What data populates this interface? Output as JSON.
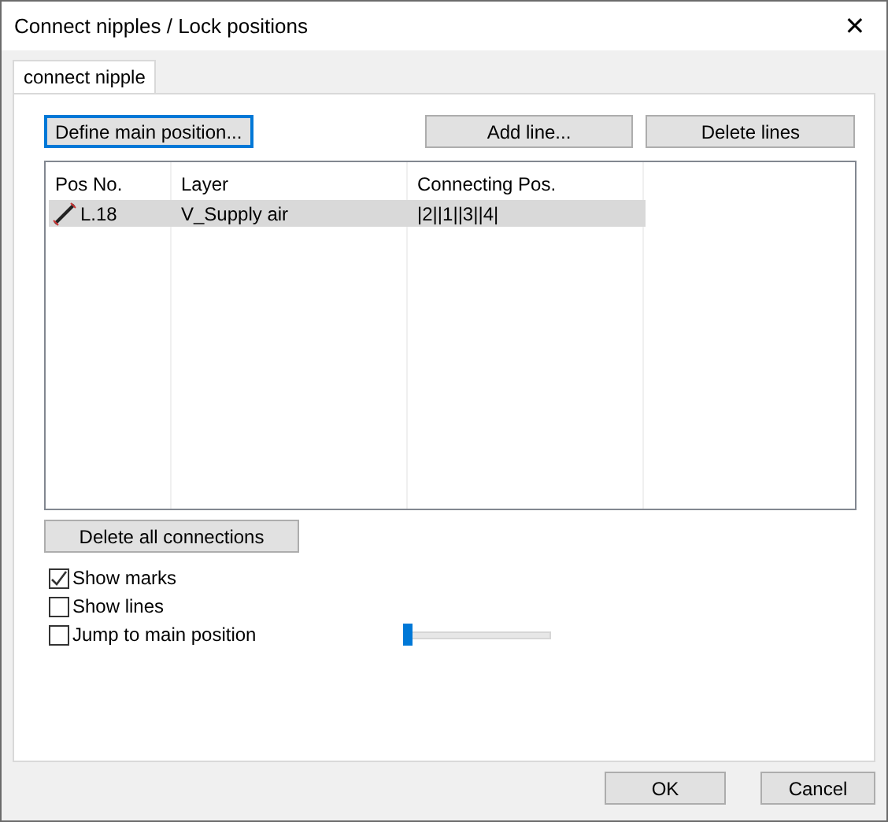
{
  "window": {
    "title": "Connect nipples / Lock positions",
    "close": "✕"
  },
  "tabs": [
    {
      "label": "connect nipple",
      "selected": true
    }
  ],
  "top_buttons": [
    {
      "label": "Define main position...",
      "focused": true
    },
    {
      "label": "Add line...",
      "focused": false
    },
    {
      "label": "Delete lines",
      "focused": false
    }
  ],
  "table": {
    "columns": [
      "Pos No.",
      "Layer",
      "Connecting Pos."
    ],
    "rows": [
      {
        "cells": [
          "L.18",
          "V_Supply air",
          "|2||1||3||4|"
        ],
        "selected": true
      }
    ]
  },
  "delete_all_button": "Delete all connections",
  "checkboxes": [
    {
      "label": "Show marks",
      "checked": true
    },
    {
      "label": "Show lines",
      "checked": false
    },
    {
      "label": "Jump to main position",
      "checked": false
    }
  ],
  "slider": {
    "level": 0
  },
  "buttons": [
    "OK",
    "Cancel"
  ]
}
